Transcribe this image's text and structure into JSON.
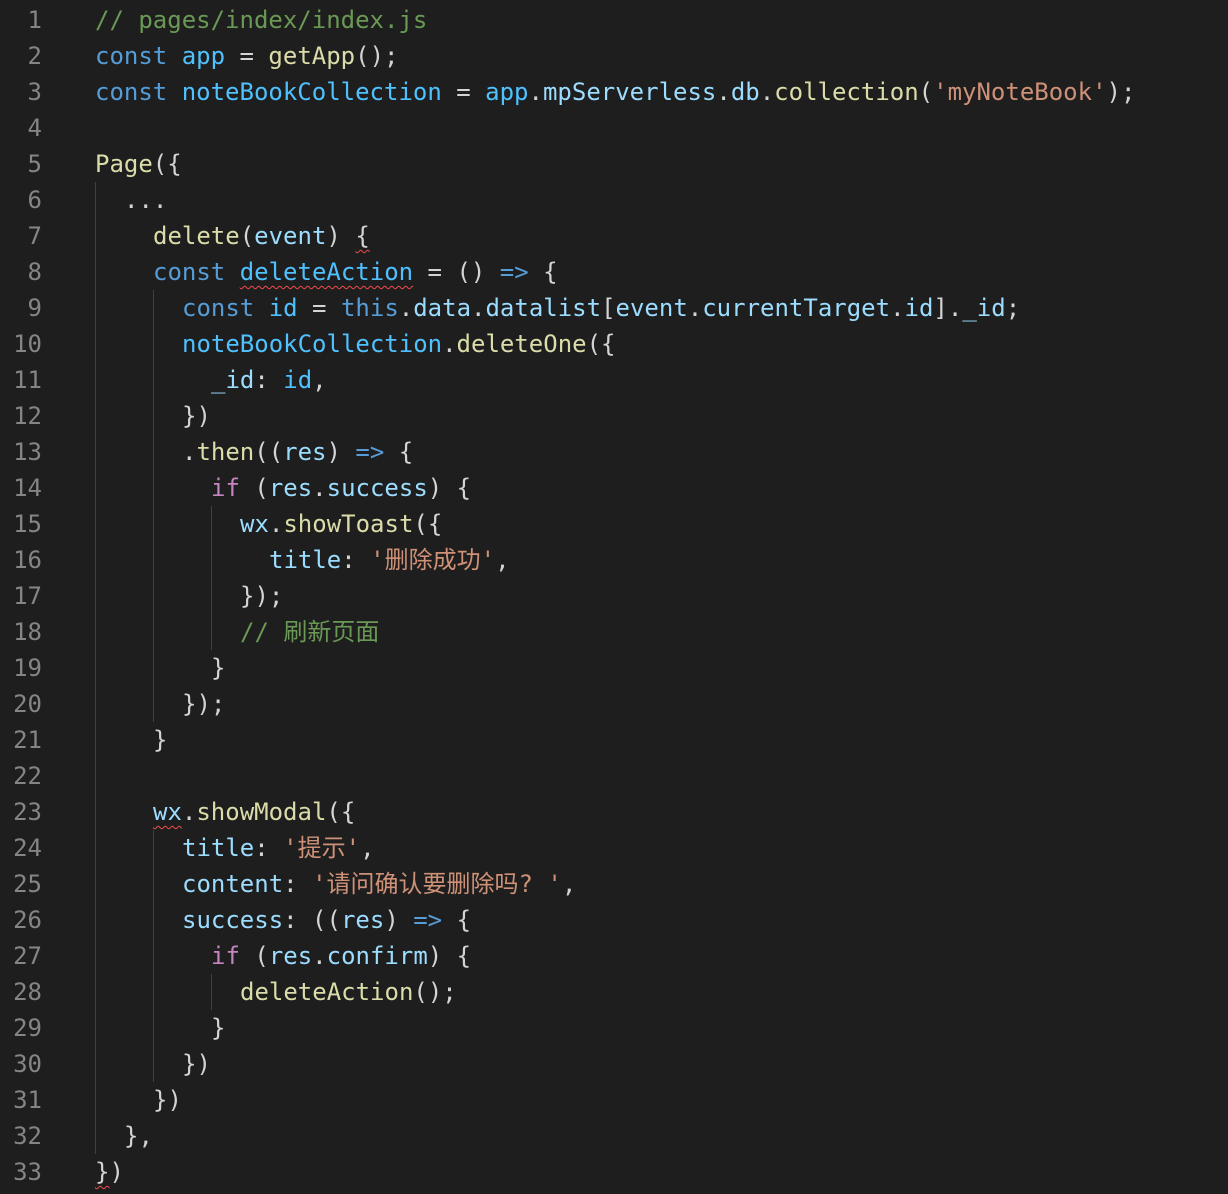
{
  "editor": {
    "language": "javascript",
    "file": "pages/index/index.js",
    "lines": [
      {
        "n": "1",
        "indent": 0,
        "tokens": [
          [
            "// pages/index/index.js",
            "comment"
          ]
        ]
      },
      {
        "n": "2",
        "indent": 0,
        "tokens": [
          [
            "const",
            "kw"
          ],
          [
            " ",
            "punc"
          ],
          [
            "app",
            "var"
          ],
          [
            " = ",
            "punc"
          ],
          [
            "getApp",
            "fn"
          ],
          [
            "();",
            "punc"
          ]
        ]
      },
      {
        "n": "3",
        "indent": 0,
        "tokens": [
          [
            "const",
            "kw"
          ],
          [
            " ",
            "punc"
          ],
          [
            "noteBookCollection",
            "var"
          ],
          [
            " = ",
            "punc"
          ],
          [
            "app",
            "var"
          ],
          [
            ".",
            "punc"
          ],
          [
            "mpServerless",
            "prop"
          ],
          [
            ".",
            "punc"
          ],
          [
            "db",
            "prop"
          ],
          [
            ".",
            "punc"
          ],
          [
            "collection",
            "fn"
          ],
          [
            "(",
            "punc"
          ],
          [
            "'myNoteBook'",
            "str"
          ],
          [
            ");",
            "punc"
          ]
        ]
      },
      {
        "n": "4",
        "indent": 0,
        "tokens": []
      },
      {
        "n": "5",
        "indent": 0,
        "tokens": [
          [
            "Page",
            "fn"
          ],
          [
            "({",
            "punc"
          ]
        ]
      },
      {
        "n": "6",
        "indent": 1,
        "tokens": [
          "...",
          "punc"
        ]
      },
      {
        "n": "7",
        "indent": 2,
        "tokens": [
          [
            "delete",
            "fn"
          ],
          [
            "(",
            "punc"
          ],
          [
            "event",
            "prop"
          ],
          [
            ") ",
            "punc"
          ],
          [
            "{",
            "punc",
            "squiggle"
          ]
        ]
      },
      {
        "n": "8",
        "indent": 2,
        "tokens": [
          [
            "const",
            "kw"
          ],
          [
            " ",
            "punc"
          ],
          [
            "deleteAction",
            "var",
            "squiggle"
          ],
          [
            " = () ",
            "punc"
          ],
          [
            "=>",
            "kw"
          ],
          [
            " {",
            "punc"
          ]
        ]
      },
      {
        "n": "9",
        "indent": 3,
        "tokens": [
          [
            "const",
            "kw"
          ],
          [
            " ",
            "punc"
          ],
          [
            "id",
            "var"
          ],
          [
            " = ",
            "punc"
          ],
          [
            "this",
            "kw"
          ],
          [
            ".",
            "punc"
          ],
          [
            "data",
            "prop"
          ],
          [
            ".",
            "punc"
          ],
          [
            "datalist",
            "prop"
          ],
          [
            "[",
            "punc"
          ],
          [
            "event",
            "prop"
          ],
          [
            ".",
            "punc"
          ],
          [
            "currentTarget",
            "prop"
          ],
          [
            ".",
            "punc"
          ],
          [
            "id",
            "prop"
          ],
          [
            "].",
            "punc"
          ],
          [
            "_id",
            "prop"
          ],
          [
            ";",
            "punc"
          ]
        ]
      },
      {
        "n": "10",
        "indent": 3,
        "tokens": [
          [
            "noteBookCollection",
            "var"
          ],
          [
            ".",
            "punc"
          ],
          [
            "deleteOne",
            "fn"
          ],
          [
            "({",
            "punc"
          ]
        ]
      },
      {
        "n": "11",
        "indent": 4,
        "tokens": [
          [
            "_id",
            "prop"
          ],
          [
            ": ",
            "punc"
          ],
          [
            "id",
            "var"
          ],
          [
            ",",
            "punc"
          ]
        ]
      },
      {
        "n": "12",
        "indent": 3,
        "tokens": [
          [
            "})",
            "punc"
          ]
        ]
      },
      {
        "n": "13",
        "indent": 3,
        "tokens": [
          [
            ".",
            "punc"
          ],
          [
            "then",
            "fn"
          ],
          [
            "((",
            "punc"
          ],
          [
            "res",
            "prop"
          ],
          [
            ") ",
            "punc"
          ],
          [
            "=>",
            "kw"
          ],
          [
            " {",
            "punc"
          ]
        ]
      },
      {
        "n": "14",
        "indent": 4,
        "tokens": [
          [
            "if",
            "ctrl"
          ],
          [
            " (",
            "punc"
          ],
          [
            "res",
            "prop"
          ],
          [
            ".",
            "punc"
          ],
          [
            "success",
            "prop"
          ],
          [
            ") {",
            "punc"
          ]
        ]
      },
      {
        "n": "15",
        "indent": 5,
        "tokens": [
          [
            "wx",
            "prop"
          ],
          [
            ".",
            "punc"
          ],
          [
            "showToast",
            "fn"
          ],
          [
            "({",
            "punc"
          ]
        ]
      },
      {
        "n": "16",
        "indent": 6,
        "tokens": [
          [
            "title",
            "prop"
          ],
          [
            ": ",
            "punc"
          ],
          [
            "'删除成功'",
            "str"
          ],
          [
            ",",
            "punc"
          ]
        ]
      },
      {
        "n": "17",
        "indent": 5,
        "tokens": [
          [
            "});",
            "punc"
          ]
        ]
      },
      {
        "n": "18",
        "indent": 5,
        "tokens": [
          [
            "// 刷新页面",
            "comment"
          ]
        ]
      },
      {
        "n": "19",
        "indent": 4,
        "tokens": [
          [
            "}",
            "punc"
          ]
        ]
      },
      {
        "n": "20",
        "indent": 3,
        "tokens": [
          [
            "});",
            "punc"
          ]
        ]
      },
      {
        "n": "21",
        "indent": 2,
        "tokens": [
          [
            "}",
            "punc"
          ]
        ]
      },
      {
        "n": "22",
        "indent": 0,
        "tokens": []
      },
      {
        "n": "23",
        "indent": 2,
        "tokens": [
          [
            "wx",
            "prop",
            "squiggle"
          ],
          [
            ".",
            "punc"
          ],
          [
            "showModal",
            "fn"
          ],
          [
            "({",
            "punc"
          ]
        ]
      },
      {
        "n": "24",
        "indent": 3,
        "tokens": [
          [
            "title",
            "prop"
          ],
          [
            ": ",
            "punc"
          ],
          [
            "'提示'",
            "str"
          ],
          [
            ",",
            "punc"
          ]
        ]
      },
      {
        "n": "25",
        "indent": 3,
        "tokens": [
          [
            "content",
            "prop"
          ],
          [
            ": ",
            "punc"
          ],
          [
            "'请问确认要删除吗? '",
            "str"
          ],
          [
            ",",
            "punc"
          ]
        ]
      },
      {
        "n": "26",
        "indent": 3,
        "tokens": [
          [
            "success",
            "prop"
          ],
          [
            ": ((",
            "punc"
          ],
          [
            "res",
            "prop"
          ],
          [
            ") ",
            "punc"
          ],
          [
            "=>",
            "kw"
          ],
          [
            " {",
            "punc"
          ]
        ]
      },
      {
        "n": "27",
        "indent": 4,
        "tokens": [
          [
            "if",
            "ctrl"
          ],
          [
            " (",
            "punc"
          ],
          [
            "res",
            "prop"
          ],
          [
            ".",
            "punc"
          ],
          [
            "confirm",
            "prop"
          ],
          [
            ") {",
            "punc"
          ]
        ]
      },
      {
        "n": "28",
        "indent": 5,
        "tokens": [
          [
            "deleteAction",
            "fn"
          ],
          [
            "();",
            "punc"
          ]
        ]
      },
      {
        "n": "29",
        "indent": 4,
        "tokens": [
          [
            "}",
            "punc"
          ]
        ]
      },
      {
        "n": "30",
        "indent": 3,
        "tokens": [
          [
            "})",
            "punc"
          ]
        ]
      },
      {
        "n": "31",
        "indent": 2,
        "tokens": [
          [
            "})",
            "punc"
          ]
        ]
      },
      {
        "n": "32",
        "indent": 1,
        "tokens": [
          [
            "},",
            "punc"
          ]
        ]
      },
      {
        "n": "33",
        "indent": 0,
        "tokens": [
          [
            "})",
            "punc",
            "squiggle-first"
          ]
        ]
      }
    ]
  }
}
